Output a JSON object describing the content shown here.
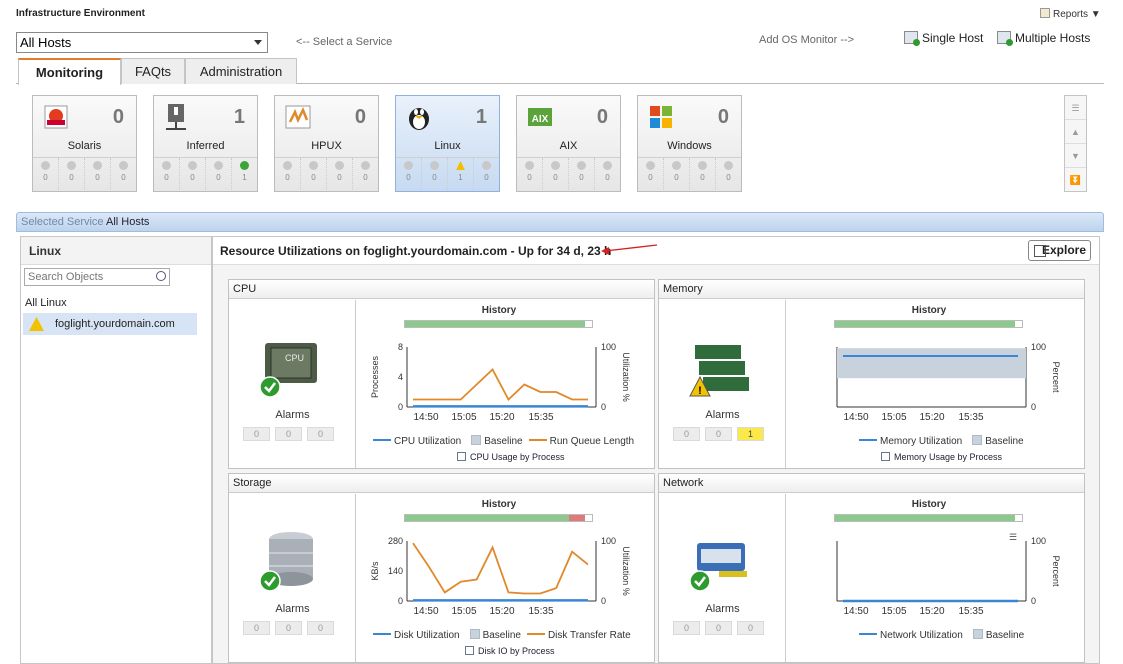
{
  "app": {
    "title": "Infrastructure Environment",
    "reports": "Reports"
  },
  "toolbar": {
    "host_select": "All Hosts",
    "service_hint": "<-- Select a Service",
    "os_monitor_hint": "Add OS Monitor -->",
    "single_host": "Single Host",
    "multiple_hosts": "Multiple Hosts"
  },
  "tabs": [
    {
      "label": "Monitoring",
      "active": true
    },
    {
      "label": "FAQts",
      "active": false
    },
    {
      "label": "Administration",
      "active": false
    }
  ],
  "os_tiles": [
    {
      "name": "Solaris",
      "count": "0",
      "alarms": [
        "0",
        "0",
        "0",
        "0"
      ]
    },
    {
      "name": "Inferred",
      "count": "1",
      "alarms": [
        "0",
        "0",
        "0",
        "1"
      ]
    },
    {
      "name": "HPUX",
      "count": "0",
      "alarms": [
        "0",
        "0",
        "0",
        "0"
      ]
    },
    {
      "name": "Linux",
      "count": "1",
      "alarms": [
        "0",
        "0",
        "1",
        "0"
      ]
    },
    {
      "name": "AIX",
      "count": "0",
      "alarms": [
        "0",
        "0",
        "0",
        "0"
      ]
    },
    {
      "name": "Windows",
      "count": "0",
      "alarms": [
        "0",
        "0",
        "0",
        "0"
      ]
    }
  ],
  "selected_service": {
    "label": "Selected Service",
    "value": "All Hosts"
  },
  "left_pane": {
    "title": "Linux",
    "search_placeholder": "Search Objects",
    "group": "All Linux",
    "host": "foglight.yourdomain.com"
  },
  "main": {
    "heading": "Resource Utilizations on foglight.yourdomain.com - Up for 34 d, 23 h",
    "explore": "Explore"
  },
  "panels": {
    "cpu": {
      "title": "CPU",
      "alarms_label": "Alarms",
      "alarms": [
        "0",
        "0",
        "0"
      ],
      "history": "History",
      "y_left_label": "Processes",
      "y_right_label": "Utilization %",
      "y_left_ticks": [
        "8",
        "4",
        "0"
      ],
      "y_right_ticks": [
        "100",
        "0"
      ],
      "x_ticks": [
        "14:50",
        "15:05",
        "15:20",
        "15:35"
      ],
      "legend": [
        "CPU Utilization",
        "Baseline",
        "Run Queue Length"
      ],
      "link": "CPU Usage by Process",
      "status": "ok"
    },
    "memory": {
      "title": "Memory",
      "alarms_label": "Alarms",
      "alarms": [
        "0",
        "0",
        "1"
      ],
      "history": "History",
      "y_right_label": "Percent",
      "y_right_ticks": [
        "100",
        "0"
      ],
      "x_ticks": [
        "14:50",
        "15:05",
        "15:20",
        "15:35"
      ],
      "legend": [
        "Memory Utilization",
        "Baseline"
      ],
      "link": "Memory Usage by Process",
      "status": "warning"
    },
    "storage": {
      "title": "Storage",
      "alarms_label": "Alarms",
      "alarms": [
        "0",
        "0",
        "0"
      ],
      "history": "History",
      "y_left_label": "KB/s",
      "y_right_label": "Utilization %",
      "y_left_ticks": [
        "280",
        "140",
        "0"
      ],
      "y_right_ticks": [
        "100",
        "0"
      ],
      "x_ticks": [
        "14:50",
        "15:05",
        "15:20",
        "15:35"
      ],
      "legend": [
        "Disk Utilization",
        "Baseline",
        "Disk Transfer Rate"
      ],
      "link": "Disk IO by Process",
      "status": "ok"
    },
    "network": {
      "title": "Network",
      "alarms_label": "Alarms",
      "alarms": [
        "0",
        "0",
        "0"
      ],
      "history": "History",
      "y_right_label": "Percent",
      "y_right_ticks": [
        "100",
        "0"
      ],
      "x_ticks": [
        "14:50",
        "15:05",
        "15:20",
        "15:35"
      ],
      "legend": [
        "Network Utilization",
        "Baseline"
      ],
      "status": "ok"
    }
  },
  "colors": {
    "utilization": "#3a86d6",
    "rate": "#e0892a",
    "baseline": "#c8d2dc",
    "ok": "#2e9b2e",
    "warning": "#f2c200",
    "history_ok": "#8cc98c",
    "history_bad": "#e07a7a"
  },
  "chart_data": [
    {
      "type": "line",
      "title": "CPU",
      "x": [
        "14:45",
        "14:50",
        "14:55",
        "15:00",
        "15:05",
        "15:10",
        "15:15",
        "15:20",
        "15:25",
        "15:30",
        "15:35",
        "15:40"
      ],
      "series": [
        {
          "name": "Run Queue Length",
          "values": [
            1,
            1,
            1,
            1,
            3,
            5,
            1,
            3,
            2,
            2,
            1,
            1
          ]
        },
        {
          "name": "CPU Utilization",
          "values": [
            1,
            1,
            1,
            1,
            1,
            1,
            1,
            1,
            1,
            1,
            1,
            1
          ]
        }
      ],
      "ylim_left": [
        0,
        8
      ],
      "ylim_right": [
        0,
        100
      ]
    },
    {
      "type": "area",
      "title": "Memory",
      "series": [
        {
          "name": "Memory Utilization",
          "values": [
            85,
            85,
            85,
            85,
            85,
            85,
            85,
            85,
            85,
            85,
            85,
            85
          ]
        }
      ],
      "baseline": [
        48,
        98
      ],
      "ylim": [
        0,
        100
      ]
    },
    {
      "type": "line",
      "title": "Storage",
      "x": [
        "14:45",
        "14:50",
        "14:55",
        "15:00",
        "15:05",
        "15:10",
        "15:15",
        "15:20",
        "15:25",
        "15:30",
        "15:35",
        "15:40"
      ],
      "series": [
        {
          "name": "Disk Transfer Rate",
          "values": [
            270,
            160,
            40,
            90,
            100,
            250,
            40,
            35,
            35,
            60,
            230,
            170
          ]
        },
        {
          "name": "Disk Utilization",
          "values": [
            1,
            1,
            1,
            1,
            1,
            1,
            1,
            1,
            1,
            1,
            1,
            1
          ]
        }
      ],
      "ylim_left": [
        0,
        280
      ],
      "ylim_right": [
        0,
        100
      ]
    },
    {
      "type": "line",
      "title": "Network",
      "series": [
        {
          "name": "Network Utilization",
          "values": [
            0,
            0,
            0,
            0,
            0,
            0,
            0,
            0,
            0,
            0,
            0,
            0
          ]
        }
      ],
      "ylim": [
        0,
        100
      ]
    }
  ]
}
